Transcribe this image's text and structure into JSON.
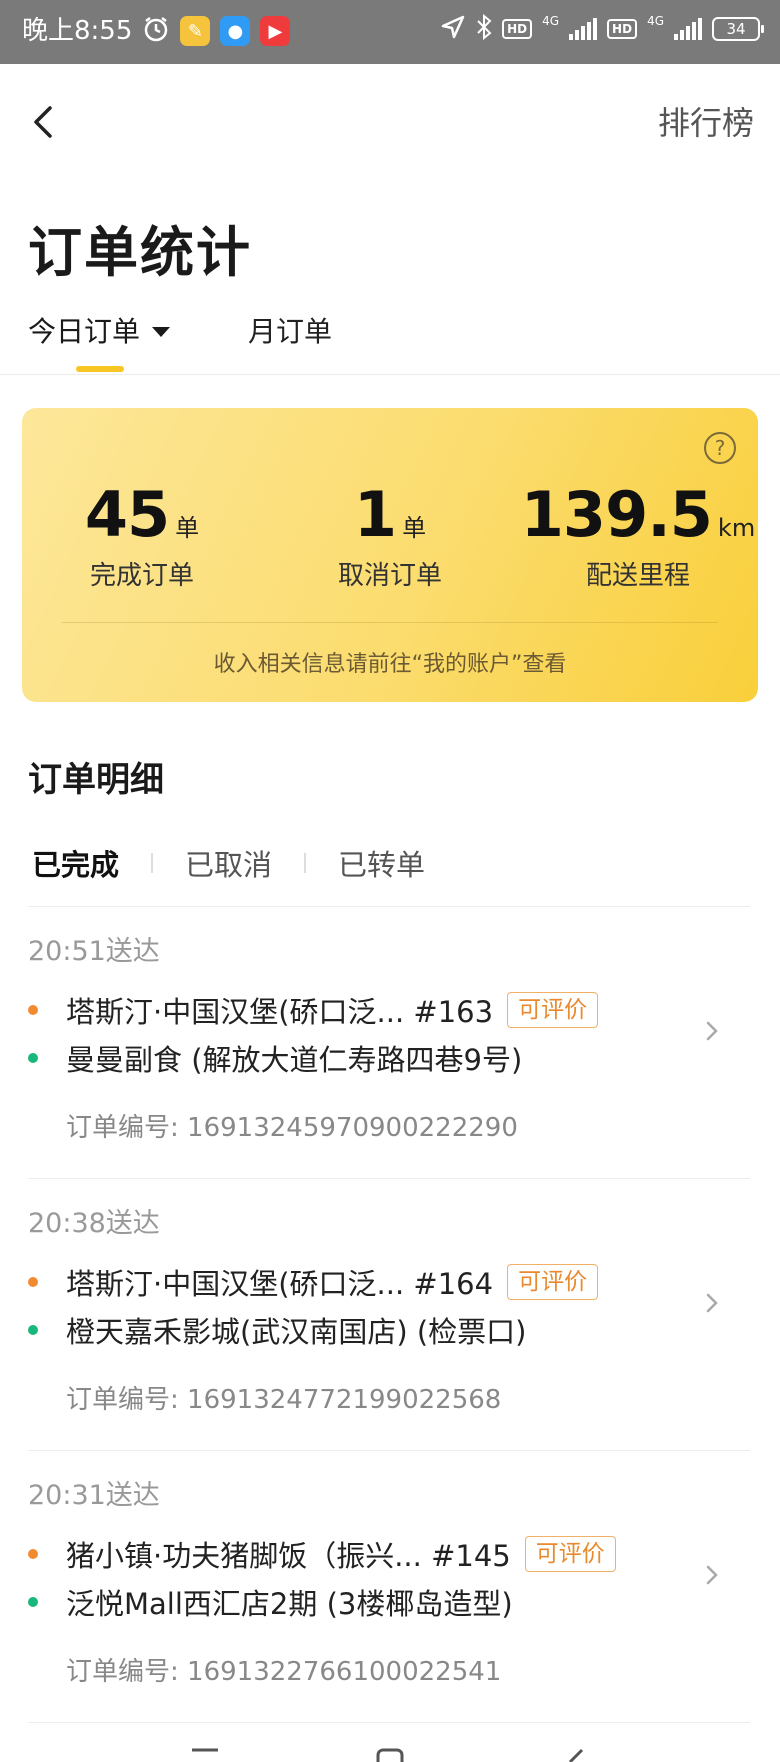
{
  "status_bar": {
    "time": "晚上8:55",
    "battery": "34",
    "network_1": "4G",
    "network_2": "4G",
    "hd_1": "HD",
    "hd_2": "HD"
  },
  "header": {
    "ranking_label": "排行榜",
    "title": "订单统计"
  },
  "tabs": {
    "today": "今日订单",
    "month": "月订单"
  },
  "stats": {
    "completed_value": "45",
    "completed_unit": "单",
    "completed_label": "完成订单",
    "cancelled_value": "1",
    "cancelled_unit": "单",
    "cancelled_label": "取消订单",
    "distance_value": "139.5",
    "distance_unit": "km",
    "distance_label": "配送里程",
    "note": "收入相关信息请前往“我的账户”查看",
    "help_symbol": "?"
  },
  "details": {
    "title": "订单明细",
    "subtabs": [
      "已完成",
      "已取消",
      "已转单"
    ]
  },
  "orders": [
    {
      "time": "20:51送达",
      "pickup": "塔斯汀·中国汉堡(硚口泛... #163",
      "badge": "可评价",
      "dropoff": "曼曼副食 (解放大道仁寿路四巷9号)",
      "order_no": "订单编号: 16913245970900222290"
    },
    {
      "time": "20:38送达",
      "pickup": "塔斯汀·中国汉堡(硚口泛... #164",
      "badge": "可评价",
      "dropoff": "橙天嘉禾影城(武汉南国店) (检票口)",
      "order_no": "订单编号: 16913247721990225​68"
    },
    {
      "time": "20:31送达",
      "pickup": "猪小镇·功夫猪脚饭（振兴... #145",
      "badge": "可评价",
      "dropoff": "泛悦Mall西汇店2期 (3楼椰岛造型)",
      "order_no": "订单编号: 16913227661000225​41"
    }
  ],
  "colors": {
    "accent_yellow": "#f7c625",
    "badge_orange": "#e88a2d",
    "pickup_dot": "#f28b30",
    "dropoff_dot": "#18b87a"
  }
}
